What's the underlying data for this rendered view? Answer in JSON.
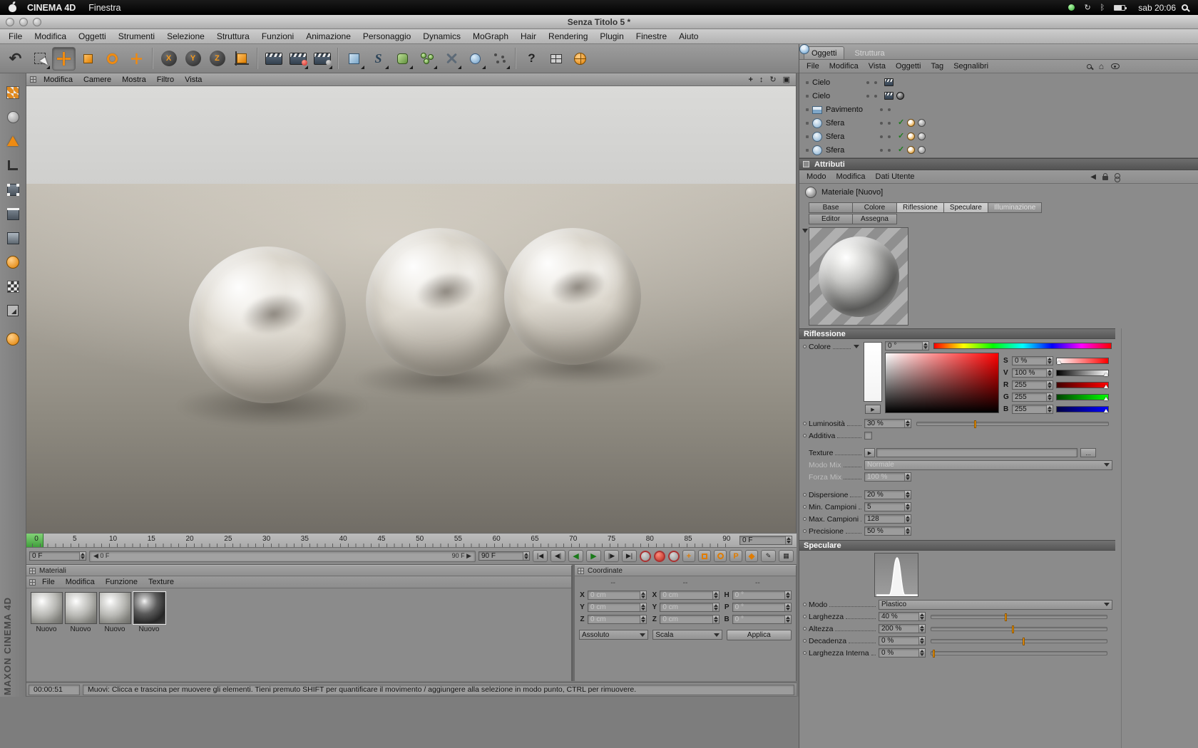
{
  "macos_menubar": {
    "app_name": "CINEMA 4D",
    "window_menu": "Finestra",
    "clock": "sab 20:06"
  },
  "window": {
    "title": "Senza Titolo 5 *"
  },
  "app_menu": [
    "File",
    "Modifica",
    "Oggetti",
    "Strumenti",
    "Selezione",
    "Struttura",
    "Funzioni",
    "Animazione",
    "Personaggio",
    "Dynamics",
    "MoGraph",
    "Hair",
    "Rendering",
    "Plugin",
    "Finestre",
    "Aiuto"
  ],
  "viewport_menu": [
    "Modifica",
    "Camere",
    "Mostra",
    "Filtro",
    "Vista"
  ],
  "timeline": {
    "ticks": [
      "0",
      "5",
      "10",
      "15",
      "20",
      "25",
      "30",
      "35",
      "40",
      "45",
      "50",
      "55",
      "60",
      "65",
      "70",
      "75",
      "80",
      "85",
      "90"
    ],
    "ruler_field": "0 F",
    "frame_field": "0 F",
    "range_start": "0 F",
    "range_end": "90 F",
    "end_field": "90 F"
  },
  "objects_panel": {
    "tabs": [
      "Oggetti",
      "Struttura"
    ],
    "menu": [
      "File",
      "Modifica",
      "Vista",
      "Oggetti",
      "Tag",
      "Segnalibri"
    ],
    "items": [
      {
        "name": "Cielo"
      },
      {
        "name": "Cielo"
      },
      {
        "name": "Pavimento"
      },
      {
        "name": "Sfera"
      },
      {
        "name": "Sfera"
      },
      {
        "name": "Sfera"
      }
    ]
  },
  "attributes": {
    "title": "Attributi",
    "menu": [
      "Modo",
      "Modifica",
      "Dati Utente"
    ],
    "material_name": "Materiale [Nuovo]",
    "channel_tabs": [
      "Base",
      "Colore",
      "Riflessione",
      "Speculare",
      "Illuminazione"
    ],
    "action_tabs": [
      "Editor",
      "Assegna"
    ],
    "riflessione": {
      "header": "Riflessione",
      "colore_label": "Colore",
      "hue_value": "0 °",
      "s_label": "S",
      "s_value": "0 %",
      "v_label": "V",
      "v_value": "100 %",
      "r_label": "R",
      "r_value": "255",
      "g_label": "G",
      "g_value": "255",
      "b_label": "B",
      "b_value": "255",
      "luminosita_label": "Luminosità",
      "luminosita_value": "30 %",
      "additiva_label": "Additiva",
      "texture_label": "Texture",
      "modo_mix_label": "Modo Mix",
      "modo_mix_value": "Normale",
      "forza_mix_label": "Forza Mix",
      "forza_mix_value": "100 %",
      "dispersione_label": "Dispersione",
      "dispersione_value": "20 %",
      "min_campioni_label": "Min. Campioni",
      "min_campioni_value": "5",
      "max_campioni_label": "Max. Campioni",
      "max_campioni_value": "128",
      "precisione_label": "Precisione",
      "precisione_value": "50 %"
    },
    "speculare": {
      "header": "Speculare",
      "modo_label": "Modo",
      "modo_value": "Plastico",
      "larghezza_label": "Larghezza",
      "larghezza_value": "40 %",
      "altezza_label": "Altezza",
      "altezza_value": "200 %",
      "decadenza_label": "Decadenza",
      "decadenza_value": "0 %",
      "larghezza_interna_label": "Larghezza Interna",
      "larghezza_interna_value": "0 %"
    }
  },
  "materials_panel": {
    "title": "Materiali",
    "menu": [
      "File",
      "Modifica",
      "Funzione",
      "Texture"
    ],
    "materials": [
      {
        "label": "Nuovo"
      },
      {
        "label": "Nuovo"
      },
      {
        "label": "Nuovo"
      },
      {
        "label": "Nuovo"
      }
    ]
  },
  "coordinates_panel": {
    "title": "Coordinate",
    "col_headers": [
      "--",
      "--",
      "--"
    ],
    "pos_labels": [
      "X",
      "Y",
      "Z"
    ],
    "scale_labels": [
      "X",
      "Y",
      "Z"
    ],
    "rot_labels": [
      "H",
      "P",
      "B"
    ],
    "pos_values": [
      "0 cm",
      "0 cm",
      "0 cm"
    ],
    "scale_values": [
      "0 cm",
      "0 cm",
      "0 cm"
    ],
    "rot_values": [
      "0 °",
      "0 °",
      "0 °"
    ],
    "mode_dropdown": "Assoluto",
    "scale_dropdown": "Scala",
    "apply_button": "Applica"
  },
  "status_bar": {
    "time": "00:00:51",
    "message": "Muovi: Clicca e trascina per muovere gli elementi. Tieni premuto SHIFT per quantificare il movimento / aggiungere alla selezione in modo punto, CTRL per rimuovere."
  },
  "branding": {
    "vertical_text": "MAXON CINEMA 4D"
  }
}
